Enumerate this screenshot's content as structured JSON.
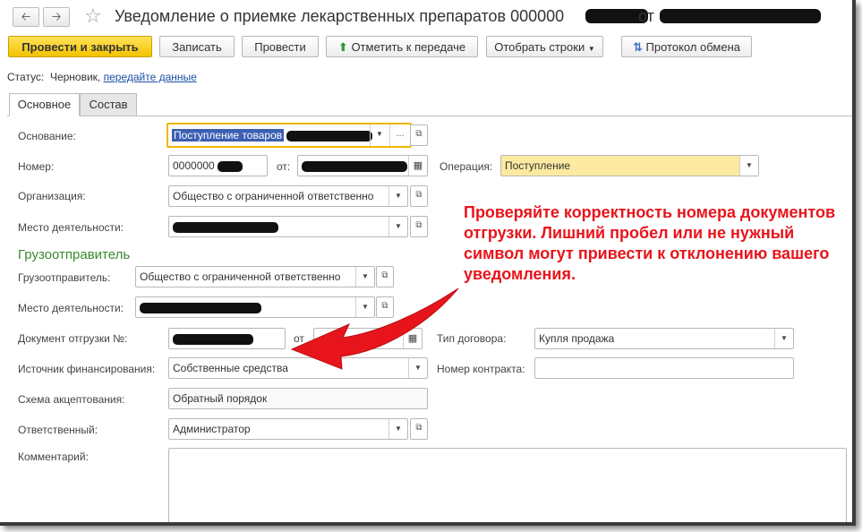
{
  "window": {
    "title": "Уведомление о приемке лекарственных препаратов 000000",
    "title_from": "от",
    "back_icon": "arrow-left-icon",
    "forward_icon": "arrow-right-icon",
    "favorite_icon": "star-icon"
  },
  "toolbar": {
    "post_close": "Провести и закрыть",
    "save": "Записать",
    "post": "Провести",
    "mark_transfer": "Отметить к передаче",
    "select_rows": "Отобрать строки",
    "exchange_log": "Протокол обмена"
  },
  "status": {
    "label": "Статус:",
    "value": "Черновик,",
    "link": "передайте данные"
  },
  "tabs": [
    {
      "label": "Основное",
      "active": true
    },
    {
      "label": "Состав",
      "active": false
    }
  ],
  "form": {
    "basis_label": "Основание:",
    "basis_value": "Поступление товаров",
    "number_label": "Номер:",
    "number_value": "0000000",
    "date_from_label": "от:",
    "operation_label": "Операция:",
    "operation_value": "Поступление",
    "org_label": "Организация:",
    "org_value": "Общество с ограниченной ответственно",
    "place_label": "Место деятельности:",
    "shipper_section": "Грузоотправитель",
    "shipper_label": "Грузоотправитель:",
    "shipper_value": "Общество с ограниченной ответственно",
    "shipper_place_label": "Место деятельности:",
    "ship_doc_label": "Документ отгрузки №:",
    "ship_doc_from": "от",
    "contract_type_label": "Тип договора:",
    "contract_type_value": "Купля продажа",
    "finance_label": "Источник финансирования:",
    "finance_value": "Собственные средства",
    "contract_num_label": "Номер контракта:",
    "contract_num_value": "",
    "accept_label": "Схема акцептования:",
    "accept_value": "Обратный порядок",
    "responsible_label": "Ответственный:",
    "responsible_value": "Администратор",
    "comment_label": "Комментарий:",
    "comment_value": ""
  },
  "annotation": "Проверяйте корректность номера документов отгрузки. Лишний пробел или не нужный символ могут привести к отклонению вашего уведомления.",
  "colors": {
    "accent": "#f3c200",
    "annotation": "#e8141b",
    "section": "#3a8a2f",
    "link": "#1a4fa0"
  }
}
